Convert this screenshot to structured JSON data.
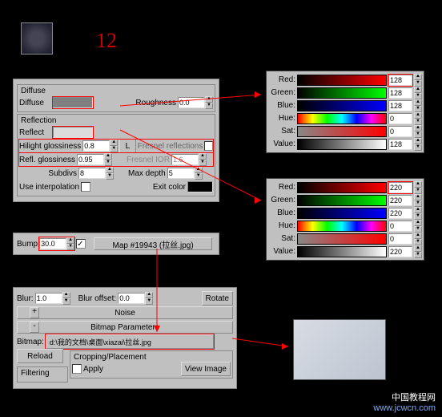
{
  "annotation_number": "12",
  "diffuse": {
    "group_title": "Diffuse",
    "diffuse_label": "Diffuse",
    "roughness_label": "Roughness",
    "roughness_value": "0.0"
  },
  "reflection": {
    "group_title": "Reflection",
    "reflect_label": "Reflect",
    "hilight_gloss_label": "Hilight glossiness",
    "hilight_gloss_value": "0.8",
    "l_button": "L",
    "fresnel_label": "Fresnel reflections",
    "refl_gloss_label": "Refl. glossiness",
    "refl_gloss_value": "0.95",
    "fresnel_ior_label": "Fresnel IOR",
    "fresnel_ior_value": "1.6",
    "subdivs_label": "Subdivs",
    "subdivs_value": "8",
    "max_depth_label": "Max depth",
    "max_depth_value": "5",
    "use_interp_label": "Use interpolation",
    "exit_color_label": "Exit color"
  },
  "bump": {
    "label": "Bump",
    "value": "30.0",
    "map_button": "Map #19943 (拉丝.jpg)"
  },
  "bitmap_params": {
    "blur_label": "Blur:",
    "blur_value": "1.0",
    "blur_offset_label": "Blur offset:",
    "blur_offset_value": "0.0",
    "rotate_label": "Rotate",
    "noise_label": "Noise",
    "header": "Bitmap Parameters",
    "bitmap_label": "Bitmap:",
    "bitmap_path": "d:\\我的文档\\桌面\\xiazai\\拉丝.jpg",
    "reload_label": "Reload",
    "cropping_label": "Cropping/Placement",
    "filtering_label": "Filtering",
    "apply_label": "Apply",
    "view_image_label": "View Image"
  },
  "color1": {
    "red_label": "Red:",
    "red_value": "128",
    "green_label": "Green:",
    "green_value": "128",
    "blue_label": "Blue:",
    "blue_value": "128",
    "hue_label": "Hue:",
    "hue_value": "0",
    "sat_label": "Sat:",
    "sat_value": "0",
    "value_label": "Value:",
    "value_value": "128"
  },
  "color2": {
    "red_label": "Red:",
    "red_value": "220",
    "green_label": "Green:",
    "green_value": "220",
    "blue_label": "Blue:",
    "blue_value": "220",
    "hue_label": "Hue:",
    "hue_value": "0",
    "sat_label": "Sat:",
    "sat_value": "0",
    "value_label": "Value:",
    "value_value": "220"
  },
  "watermark": {
    "line1": "中国教程网",
    "line2": "www.jcwcn.com"
  }
}
